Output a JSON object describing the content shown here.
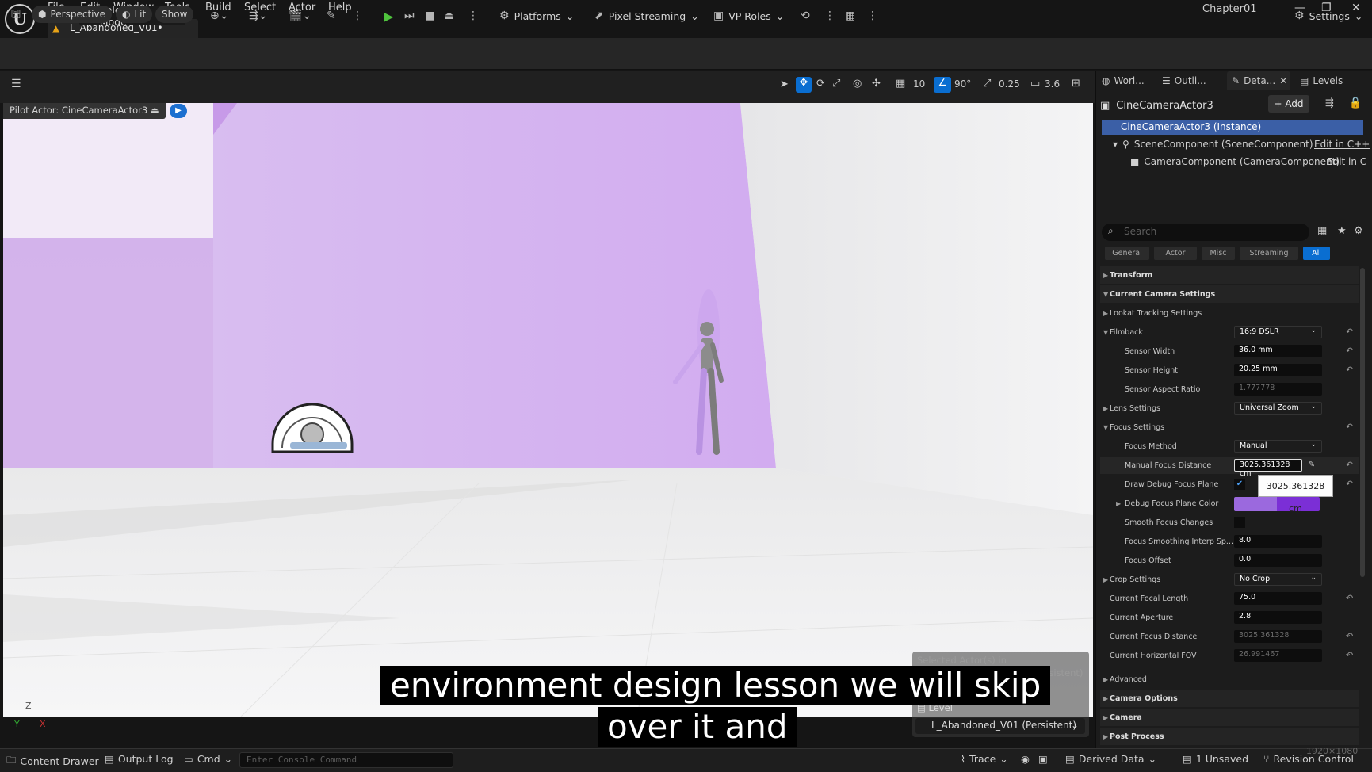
{
  "menubar": {
    "items": [
      "File",
      "Edit",
      "Window",
      "Tools",
      "Build",
      "Select",
      "Actor",
      "Help"
    ],
    "level_tab": "L_Abandoned_V01•",
    "project": "Chapter01"
  },
  "toolbar": {
    "selection_mode": "Selection Mode",
    "platforms": "Platforms",
    "pixel_streaming": "Pixel Streaming",
    "vp_roles": "VP Roles",
    "settings": "Settings"
  },
  "viewport": {
    "perspective": "Perspective",
    "lit": "Lit",
    "show": "Show",
    "grid": "10",
    "angle": "90°",
    "scale": "0.25",
    "camera_speed": "3.6",
    "pilot_label": "Pilot Actor: CineCameraActor3",
    "axis_z": "Z",
    "axis_y": "Y",
    "axis_x": "X",
    "resolution": "1920×1080"
  },
  "subtitles": {
    "line1": "environment design lesson we will skip",
    "line2": "over it and"
  },
  "selection_panel": {
    "title": "Selected Actor(s) in",
    "sub": "L_Abandoned_V01 (Persistent)",
    "level_label": "Level",
    "level_value": "L_Abandoned_V01 (Persistent)"
  },
  "statusbar": {
    "content_drawer": "Content Drawer",
    "output_log": "Output Log",
    "cmd": "Cmd",
    "console_placeholder": "Enter Console Command",
    "trace": "Trace",
    "derived_data": "Derived Data",
    "unsaved": "1 Unsaved",
    "revision_control": "Revision Control"
  },
  "right_panel": {
    "tabs": [
      "Worl...",
      "Outli...",
      "Deta...",
      "Levels"
    ],
    "actor_name": "CineCameraActor3",
    "add_label": "Add",
    "tree": {
      "root": "CineCameraActor3 (Instance)",
      "scene": "SceneComponent (SceneComponent)",
      "scene_edit": "Edit in C++",
      "camera": "CameraComponent (CameraComponent)",
      "camera_edit": "Edit in C"
    },
    "search_placeholder": "Search",
    "filters": [
      "General",
      "Actor",
      "Misc",
      "Streaming",
      "All"
    ],
    "tooltip": "3025.361328 cm",
    "rows": [
      {
        "name": "Transform"
      },
      {
        "name": "Current Camera Settings"
      },
      {
        "name": "Lookat Tracking Settings"
      },
      {
        "name": "Filmback",
        "value": "16:9 DSLR"
      },
      {
        "name": "Sensor Width",
        "value": "36.0 mm"
      },
      {
        "name": "Sensor Height",
        "value": "20.25 mm"
      },
      {
        "name": "Sensor Aspect Ratio",
        "value": "1.777778"
      },
      {
        "name": "Lens Settings",
        "value": "Universal Zoom"
      },
      {
        "name": "Focus Settings"
      },
      {
        "name": "Focus Method",
        "value": "Manual"
      },
      {
        "name": "Manual Focus Distance",
        "value": "3025.361328 cm"
      },
      {
        "name": "Draw Debug Focus Plane",
        "checked": true
      },
      {
        "name": "Debug Focus Plane Color",
        "color": "#7b2fd6"
      },
      {
        "name": "Smooth Focus Changes",
        "checked": false
      },
      {
        "name": "Focus Smoothing Interp Sp...",
        "value": "8.0"
      },
      {
        "name": "Focus Offset",
        "value": "0.0"
      },
      {
        "name": "Crop Settings",
        "value": "No Crop"
      },
      {
        "name": "Current Focal Length",
        "value": "75.0"
      },
      {
        "name": "Current Aperture",
        "value": "2.8"
      },
      {
        "name": "Current Focus Distance",
        "value": "3025.361328"
      },
      {
        "name": "Current Horizontal FOV",
        "value": "26.991467"
      },
      {
        "name": "Advanced"
      },
      {
        "name": "Camera Options"
      },
      {
        "name": "Camera"
      },
      {
        "name": "Post Process"
      }
    ]
  },
  "colors": {
    "accent": "#0a6ed1",
    "focus_plane": "#b98ae0"
  }
}
